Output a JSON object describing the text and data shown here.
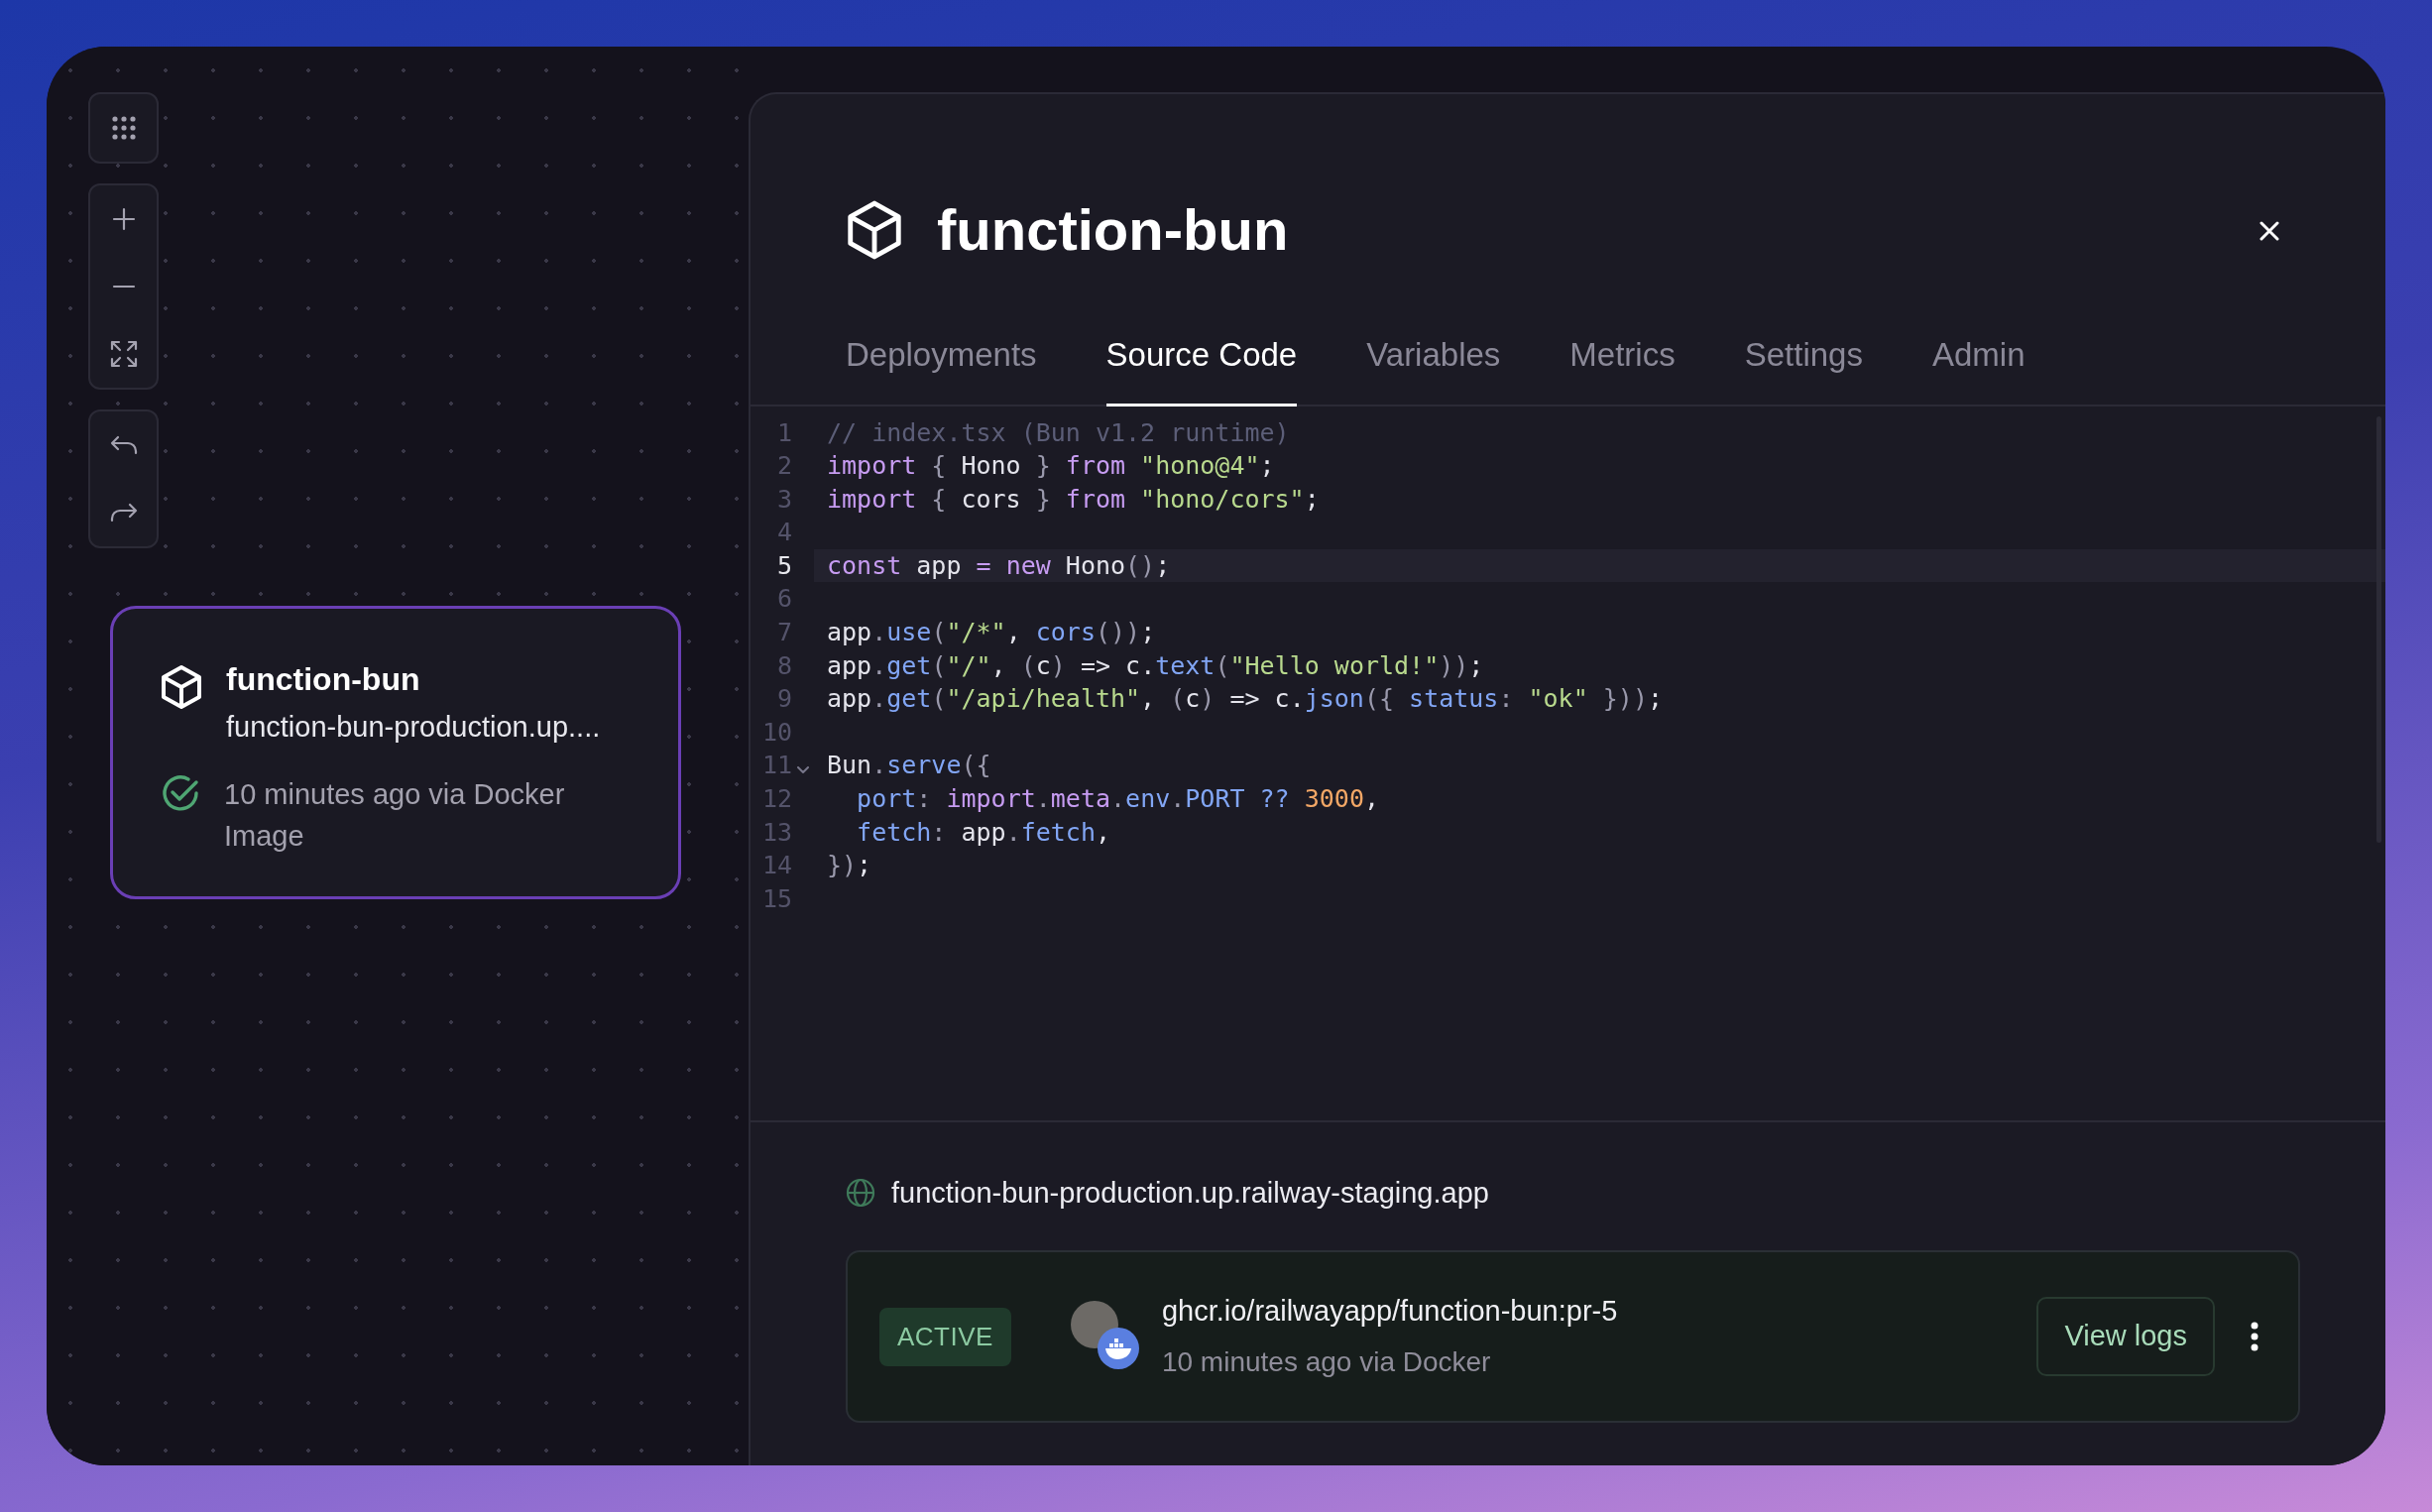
{
  "service_card": {
    "title": "function-bun",
    "url": "function-bun-production.up....",
    "status_text": "10 minutes ago via Docker Image"
  },
  "panel": {
    "title": "function-bun",
    "tabs": [
      {
        "label": "Deployments",
        "selected": false
      },
      {
        "label": "Source Code",
        "selected": true
      },
      {
        "label": "Variables",
        "selected": false
      },
      {
        "label": "Metrics",
        "selected": false
      },
      {
        "label": "Settings",
        "selected": false
      },
      {
        "label": "Admin",
        "selected": false
      }
    ],
    "code": {
      "lines": [
        {
          "number": "1",
          "current": false,
          "foldable": false,
          "tokens": [
            {
              "kind": "comment",
              "text": "// index.tsx (Bun v1.2 runtime)"
            }
          ]
        },
        {
          "number": "2",
          "current": false,
          "foldable": false,
          "tokens": [
            {
              "kind": "keyword",
              "text": "import"
            },
            {
              "kind": "punct",
              "text": " { "
            },
            {
              "kind": "plain",
              "text": "Hono"
            },
            {
              "kind": "punct",
              "text": " } "
            },
            {
              "kind": "keyword",
              "text": "from "
            },
            {
              "kind": "string",
              "text": "\"hono@4\""
            },
            {
              "kind": "plain",
              "text": ";"
            }
          ]
        },
        {
          "number": "3",
          "current": false,
          "foldable": false,
          "tokens": [
            {
              "kind": "keyword",
              "text": "import"
            },
            {
              "kind": "punct",
              "text": " { "
            },
            {
              "kind": "plain",
              "text": "cors"
            },
            {
              "kind": "punct",
              "text": " } "
            },
            {
              "kind": "keyword",
              "text": "from "
            },
            {
              "kind": "string",
              "text": "\"hono/cors\""
            },
            {
              "kind": "plain",
              "text": ";"
            }
          ]
        },
        {
          "number": "4",
          "current": false,
          "foldable": false
        },
        {
          "number": "5",
          "current": true,
          "foldable": false,
          "tokens": [
            {
              "kind": "keyword",
              "text": "const"
            },
            {
              "kind": "plain",
              "text": " app "
            },
            {
              "kind": "keyword",
              "text": "= new"
            },
            {
              "kind": "plain",
              "text": " Hono"
            },
            {
              "kind": "punct",
              "text": "()"
            },
            {
              "kind": "plain",
              "text": ";"
            }
          ]
        },
        {
          "number": "6",
          "current": false,
          "foldable": false
        },
        {
          "number": "7",
          "current": false,
          "foldable": false,
          "tokens": [
            {
              "kind": "plain",
              "text": "app"
            },
            {
              "kind": "punct",
              "text": "."
            },
            {
              "kind": "func",
              "text": "use"
            },
            {
              "kind": "punct",
              "text": "("
            },
            {
              "kind": "string",
              "text": "\"/*\""
            },
            {
              "kind": "plain",
              "text": ", "
            },
            {
              "kind": "func",
              "text": "cors"
            },
            {
              "kind": "punct",
              "text": "())"
            },
            {
              "kind": "plain",
              "text": ";"
            }
          ]
        },
        {
          "number": "8",
          "current": false,
          "foldable": false,
          "tokens": [
            {
              "kind": "plain",
              "text": "app"
            },
            {
              "kind": "punct",
              "text": "."
            },
            {
              "kind": "func",
              "text": "get"
            },
            {
              "kind": "punct",
              "text": "("
            },
            {
              "kind": "string",
              "text": "\"/\""
            },
            {
              "kind": "plain",
              "text": ", "
            },
            {
              "kind": "punct",
              "text": "("
            },
            {
              "kind": "plain",
              "text": "c"
            },
            {
              "kind": "punct",
              "text": ")"
            },
            {
              "kind": "plain",
              "text": " => c."
            },
            {
              "kind": "func",
              "text": "text"
            },
            {
              "kind": "punct",
              "text": "("
            },
            {
              "kind": "string",
              "text": "\"Hello world!\""
            },
            {
              "kind": "punct",
              "text": "))"
            },
            {
              "kind": "plain",
              "text": ";"
            }
          ]
        },
        {
          "number": "9",
          "current": false,
          "foldable": false,
          "tokens": [
            {
              "kind": "plain",
              "text": "app"
            },
            {
              "kind": "punct",
              "text": "."
            },
            {
              "kind": "func",
              "text": "get"
            },
            {
              "kind": "punct",
              "text": "("
            },
            {
              "kind": "string",
              "text": "\"/api/health\""
            },
            {
              "kind": "plain",
              "text": ", "
            },
            {
              "kind": "punct",
              "text": "("
            },
            {
              "kind": "plain",
              "text": "c"
            },
            {
              "kind": "punct",
              "text": ")"
            },
            {
              "kind": "plain",
              "text": " => c."
            },
            {
              "kind": "func",
              "text": "json"
            },
            {
              "kind": "punct",
              "text": "({ "
            },
            {
              "kind": "func",
              "text": "status"
            },
            {
              "kind": "punct",
              "text": ": "
            },
            {
              "kind": "string",
              "text": "\"ok\""
            },
            {
              "kind": "punct",
              "text": " }))"
            },
            {
              "kind": "plain",
              "text": ";"
            }
          ]
        },
        {
          "number": "10",
          "current": false,
          "foldable": false
        },
        {
          "number": "11",
          "current": false,
          "foldable": true,
          "tokens": [
            {
              "kind": "plain",
              "text": "Bun"
            },
            {
              "kind": "punct",
              "text": "."
            },
            {
              "kind": "func",
              "text": "serve"
            },
            {
              "kind": "punct",
              "text": "({"
            }
          ]
        },
        {
          "number": "12",
          "current": false,
          "foldable": false,
          "tokens": [
            {
              "kind": "func",
              "text": "  port"
            },
            {
              "kind": "punct",
              "text": ": "
            },
            {
              "kind": "keyword",
              "text": "import"
            },
            {
              "kind": "punct",
              "text": "."
            },
            {
              "kind": "keyword",
              "text": "meta"
            },
            {
              "kind": "punct",
              "text": "."
            },
            {
              "kind": "func",
              "text": "env"
            },
            {
              "kind": "punct",
              "text": "."
            },
            {
              "kind": "func",
              "text": "PORT"
            },
            {
              "kind": "func",
              "text": " ?? "
            },
            {
              "kind": "number",
              "text": "3000"
            },
            {
              "kind": "plain",
              "text": ","
            }
          ]
        },
        {
          "number": "13",
          "current": false,
          "foldable": false,
          "tokens": [
            {
              "kind": "func",
              "text": "  fetch"
            },
            {
              "kind": "punct",
              "text": ": "
            },
            {
              "kind": "plain",
              "text": "app"
            },
            {
              "kind": "punct",
              "text": "."
            },
            {
              "kind": "func",
              "text": "fetch"
            },
            {
              "kind": "plain",
              "text": ","
            }
          ]
        },
        {
          "number": "14",
          "current": false,
          "foldable": false,
          "tokens": [
            {
              "kind": "punct",
              "text": "})"
            },
            {
              "kind": "plain",
              "text": ";"
            }
          ]
        },
        {
          "number": "15",
          "current": false,
          "foldable": false
        }
      ]
    },
    "domain": "function-bun-production.up.railway-staging.app",
    "deployment": {
      "status": "ACTIVE",
      "image": "ghcr.io/railwayapp/function-bun:pr-5",
      "meta": "10 minutes ago via Docker",
      "action": "View logs"
    }
  }
}
